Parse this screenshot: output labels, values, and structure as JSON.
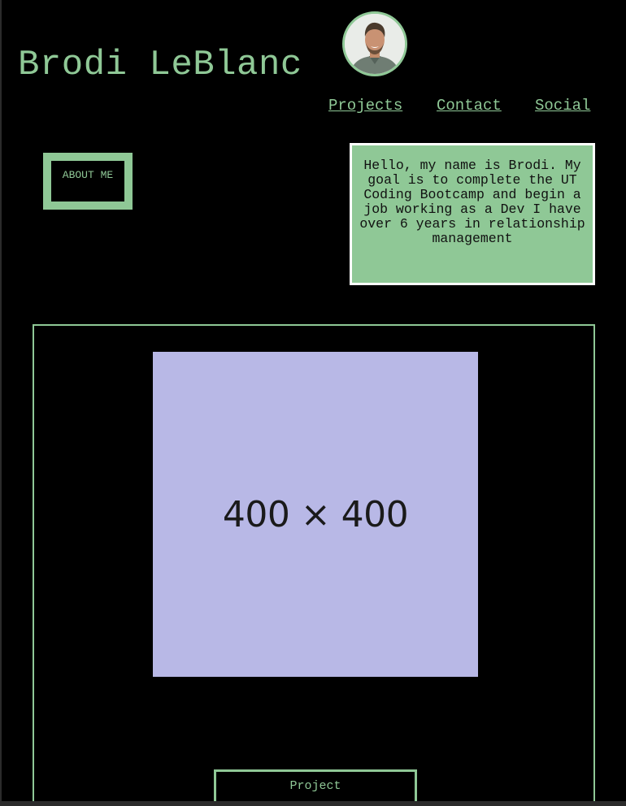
{
  "header": {
    "title": "Brodi LeBlanc",
    "avatar_alt": "profile-photo"
  },
  "nav": {
    "links": [
      {
        "label": "Projects"
      },
      {
        "label": "Contact"
      },
      {
        "label": "Social"
      }
    ]
  },
  "about": {
    "button_label": "ABOUT ME",
    "bio": "Hello, my name is Brodi. My goal is to complete the UT Coding Bootcamp and begin a job working as a Dev I have over 6 years in relationship management"
  },
  "project": {
    "placeholder_text": "400 × 400",
    "button_label": "Project"
  },
  "colors": {
    "accent": "#8fc896",
    "background": "#000000",
    "placeholder": "#b8b8e6",
    "bio_border": "#ffffff"
  }
}
